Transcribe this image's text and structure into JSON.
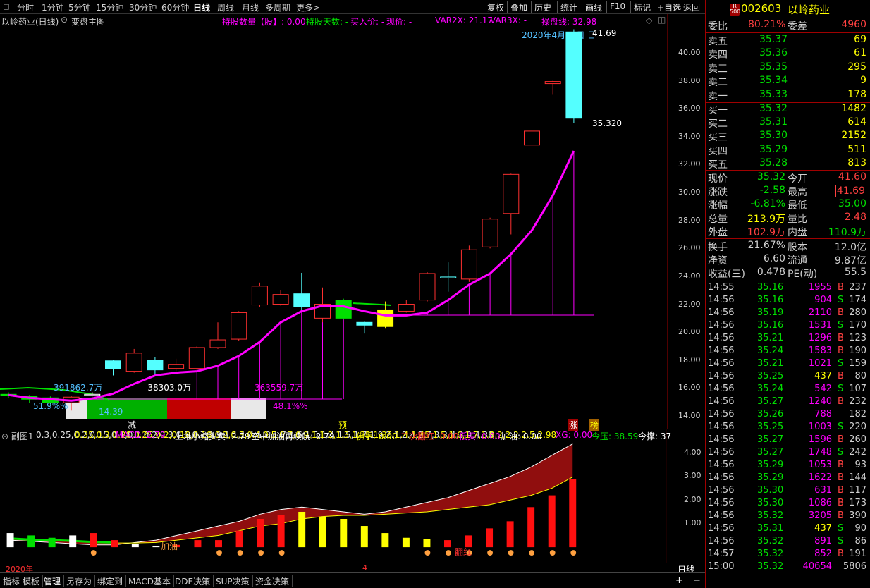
{
  "toolbar": {
    "periods": [
      "分时",
      "1分钟",
      "5分钟",
      "15分钟",
      "30分钟",
      "60分钟",
      "日线",
      "周线",
      "月线",
      "多周期",
      "更多>"
    ],
    "active_period": "日线",
    "right_buttons": [
      "复权",
      "叠加",
      "历史",
      "统计",
      "画线",
      "F10",
      "标记",
      "+自选",
      "返回"
    ]
  },
  "chart_header": {
    "title": "以岭药业(日线)",
    "formula_name": "变盘主图",
    "holding_qty": "持股数量【股】: 0.00",
    "holding_days": "持股天数: -",
    "buy_price": "买入价: -",
    "current_price": "现价: -",
    "var2x": "VAR2X: 21.17",
    "var3x": "VAR3X: -",
    "op_line": "操盘线: 32.98",
    "date_label": "2020年4月17日",
    "tooltip_prefix": "日"
  },
  "main_chart": {
    "y_ticks": [
      "40.00",
      "38.00",
      "36.00",
      "34.00",
      "32.00",
      "30.00",
      "28.00",
      "26.00",
      "24.00",
      "22.00",
      "20.00",
      "18.00",
      "16.00",
      "14.00"
    ],
    "annotations": {
      "high_value": "41.69",
      "low_value": "35.320",
      "vol1": "391862.7万",
      "vol2": "-38303.0万",
      "vol3": "363559.7万",
      "pct1": "51.9%%",
      "pct2": "48.1%%",
      "low_marker": "14.39",
      "sign_jian": "减",
      "sign_yu": "预",
      "sign_zhang": "涨",
      "sign_bang": "榜"
    },
    "candles": [
      {
        "o": 15.55,
        "c": 15.45,
        "h": 15.7,
        "l": 15.3,
        "t": "down"
      },
      {
        "o": 15.4,
        "c": 15.2,
        "h": 15.5,
        "l": 14.95,
        "t": "down"
      },
      {
        "o": 15.3,
        "c": 14.95,
        "h": 15.4,
        "l": 14.8,
        "t": "down"
      },
      {
        "o": 14.95,
        "c": 15.35,
        "h": 15.45,
        "l": 14.39,
        "t": "up"
      },
      {
        "o": 15.5,
        "c": 15.55,
        "h": 15.7,
        "l": 15.4,
        "t": "flat"
      },
      {
        "o": 17.4,
        "c": 17.95,
        "h": 18.0,
        "l": 16.9,
        "t": "cyan"
      },
      {
        "o": 17.2,
        "c": 18.5,
        "h": 18.8,
        "l": 17.1,
        "t": "up"
      },
      {
        "o": 17.3,
        "c": 18.0,
        "h": 18.2,
        "l": 16.95,
        "t": "cyan"
      },
      {
        "o": 17.4,
        "c": 17.7,
        "h": 18.1,
        "l": 17.2,
        "t": "up"
      },
      {
        "o": 17.4,
        "c": 18.9,
        "h": 19.0,
        "l": 17.3,
        "t": "up"
      },
      {
        "o": 18.9,
        "c": 19.45,
        "h": 20.7,
        "l": 18.8,
        "t": "up"
      },
      {
        "o": 19.5,
        "c": 21.4,
        "h": 21.5,
        "l": 19.4,
        "t": "up"
      },
      {
        "o": 21.95,
        "c": 23.3,
        "h": 23.55,
        "l": 21.8,
        "t": "up"
      },
      {
        "o": 22.0,
        "c": 22.7,
        "h": 23.0,
        "l": 21.9,
        "t": "up"
      },
      {
        "o": 22.75,
        "c": 21.8,
        "h": 24.25,
        "l": 21.6,
        "t": "cyan"
      },
      {
        "o": 21.0,
        "c": 22.0,
        "h": 23.2,
        "l": 20.7,
        "t": "up"
      },
      {
        "o": 22.3,
        "c": 21.0,
        "h": 22.4,
        "l": 20.9,
        "t": "green"
      },
      {
        "o": 20.7,
        "c": 20.5,
        "h": 20.75,
        "l": 19.9,
        "t": "cyan"
      },
      {
        "o": 20.4,
        "c": 21.6,
        "h": 22.2,
        "l": 20.3,
        "t": "yellow"
      },
      {
        "o": 21.5,
        "c": 22.0,
        "h": 22.3,
        "l": 21.4,
        "t": "up"
      },
      {
        "o": 22.3,
        "c": 24.2,
        "h": 24.3,
        "l": 22.2,
        "t": "up"
      },
      {
        "o": 23.9,
        "c": 23.95,
        "h": 25.0,
        "l": 22.9,
        "t": "cross"
      },
      {
        "o": 23.8,
        "c": 25.9,
        "h": 26.2,
        "l": 23.6,
        "t": "up"
      },
      {
        "o": 26.1,
        "c": 28.1,
        "h": 28.2,
        "l": 26.0,
        "t": "up"
      },
      {
        "o": 28.5,
        "c": 31.3,
        "h": 31.35,
        "l": 27.0,
        "t": "up"
      },
      {
        "o": 33.4,
        "c": 34.4,
        "h": 34.4,
        "l": 32.6,
        "t": "up"
      },
      {
        "o": 37.8,
        "c": 37.95,
        "h": 38.0,
        "l": 37.0,
        "t": "up"
      },
      {
        "o": 41.5,
        "c": 35.32,
        "h": 41.69,
        "l": 35.0,
        "t": "cyan"
      }
    ],
    "ma": [
      15.5,
      15.3,
      15.2,
      15.1,
      15.25,
      15.6,
      16.3,
      16.9,
      17.1,
      17.2,
      17.6,
      18.3,
      19.3,
      20.7,
      21.5,
      21.9,
      21.85,
      21.5,
      21.2,
      21.2,
      21.4,
      22.3,
      23.4,
      24.2,
      25.6,
      27.3,
      29.8,
      32.98
    ]
  },
  "sub_chart": {
    "header_name": "副图1",
    "dif": [
      0.3,
      0.25,
      0.2,
      0.15,
      0.1,
      0.1,
      0.2,
      0.3,
      0.5,
      0.7,
      0.9,
      1.1,
      1.4,
      1.6,
      1.7,
      1.6,
      1.5,
      1.4,
      1.5,
      1.7,
      1.9,
      2.1,
      2.4,
      2.7,
      3.0,
      3.4,
      3.9,
      4.38
    ],
    "dea": [
      0.35,
      0.3,
      0.28,
      0.25,
      0.2,
      0.18,
      0.18,
      0.2,
      0.3,
      0.4,
      0.5,
      0.7,
      0.9,
      1.0,
      1.2,
      1.3,
      1.35,
      1.35,
      1.4,
      1.45,
      1.5,
      1.6,
      1.7,
      1.8,
      2.0,
      2.2,
      2.5,
      2.98
    ],
    "macd": "MACD: 2.79",
    "l1": "上堆小缩头卖: 2.79",
    "l2": "空中加油再续航: 2.79",
    "l3": "佛手: 0.00",
    "l4": "二次翻红: 0.00",
    "l5": "低买: 0.00",
    "l6": "加油: 0.00",
    "xg": "XG: 0.00",
    "jinya": "今压: 38.59",
    "jincheng": "今撑: 37",
    "y_ticks": [
      "4.00",
      "3.00",
      "2.00",
      "1.00"
    ],
    "label_jiayou": "加油",
    "label_fanhong": "翻红",
    "bars": [
      0.6,
      0.5,
      0.4,
      0.5,
      0.6,
      0.3,
      0.15,
      0.05,
      0.1,
      0.3,
      0.3,
      0.7,
      1.2,
      1.35,
      1.5,
      1.3,
      1.2,
      0.9,
      0.6,
      0.4,
      0.35,
      0.3,
      0.5,
      0.8,
      1.1,
      1.7,
      2.2,
      2.9,
      2.8
    ],
    "bar_colors": [
      "white",
      "green",
      "green",
      "white",
      "red",
      "red",
      "white",
      "white",
      "red",
      "red",
      "red",
      "red",
      "red",
      "red",
      "yellow",
      "yellow",
      "yellow",
      "yellow",
      "yellow",
      "yellow",
      "yellow",
      "red",
      "red",
      "red",
      "red",
      "red",
      "red",
      "red",
      "yellow"
    ]
  },
  "date_bar": {
    "year": "2020年",
    "month": "4",
    "period_label": "日线"
  },
  "bottom_tabs": [
    "指标",
    "模板",
    "管理",
    "另存为",
    "绑定到",
    "MACD基本",
    "DDE决策",
    "SUP决策",
    "资金决策"
  ],
  "bottom_controls": [
    "+",
    "−"
  ],
  "quote": {
    "badge_top": "R",
    "badge_bottom": "500",
    "code": "002603",
    "name": "以岭药业",
    "weibi_label": "委比",
    "weibi": "80.21%",
    "weicha_label": "委差",
    "weicha": "4960",
    "asks": [
      {
        "label": "卖五",
        "price": "35.37",
        "vol": "69"
      },
      {
        "label": "卖四",
        "price": "35.36",
        "vol": "61"
      },
      {
        "label": "卖三",
        "price": "35.35",
        "vol": "295"
      },
      {
        "label": "卖二",
        "price": "35.34",
        "vol": "9"
      },
      {
        "label": "卖一",
        "price": "35.33",
        "vol": "178"
      }
    ],
    "bids": [
      {
        "label": "买一",
        "price": "35.32",
        "vol": "1482"
      },
      {
        "label": "买二",
        "price": "35.31",
        "vol": "614"
      },
      {
        "label": "买三",
        "price": "35.30",
        "vol": "2152"
      },
      {
        "label": "买四",
        "price": "35.29",
        "vol": "511"
      },
      {
        "label": "买五",
        "price": "35.28",
        "vol": "813"
      }
    ],
    "stats": [
      {
        "l1": "现价",
        "v1": "35.32",
        "c1": "#00e000",
        "l2": "今开",
        "v2": "41.60",
        "c2": "#ff4040"
      },
      {
        "l1": "涨跌",
        "v1": "-2.58",
        "c1": "#00e000",
        "l2": "最高",
        "v2": "41.69",
        "c2": "#ff4040",
        "box": true
      },
      {
        "l1": "涨幅",
        "v1": "-6.81%",
        "c1": "#00e000",
        "l2": "最低",
        "v2": "35.00",
        "c2": "#00e000"
      },
      {
        "l1": "总量",
        "v1": "213.9万",
        "c1": "#ffff00",
        "l2": "量比",
        "v2": "2.48",
        "c2": "#ff4040"
      },
      {
        "l1": "外盘",
        "v1": "102.9万",
        "c1": "#ff4040",
        "l2": "内盘",
        "v2": "110.9万",
        "c2": "#00e000"
      }
    ],
    "fundamentals": [
      {
        "l1": "换手",
        "v1": "21.67%",
        "l2": "股本",
        "v2": "12.0亿"
      },
      {
        "l1": "净资",
        "v1": "6.60",
        "l2": "流通",
        "v2": "9.87亿"
      },
      {
        "l1": "收益(三)",
        "v1": "0.478",
        "l2": "PE(动)",
        "v2": "55.5"
      }
    ],
    "ticks": [
      {
        "t": "14:55",
        "p": "35.16",
        "v": "1955",
        "bs": "B",
        "n": "237"
      },
      {
        "t": "14:56",
        "p": "35.16",
        "v": "904",
        "bs": "S",
        "n": "174"
      },
      {
        "t": "14:56",
        "p": "35.19",
        "v": "2110",
        "bs": "B",
        "n": "280"
      },
      {
        "t": "14:56",
        "p": "35.16",
        "v": "1531",
        "bs": "S",
        "n": "170"
      },
      {
        "t": "14:56",
        "p": "35.21",
        "v": "1296",
        "bs": "B",
        "n": "123"
      },
      {
        "t": "14:56",
        "p": "35.24",
        "v": "1583",
        "bs": "B",
        "n": "190"
      },
      {
        "t": "14:56",
        "p": "35.21",
        "v": "1021",
        "bs": "S",
        "n": "159"
      },
      {
        "t": "14:56",
        "p": "35.25",
        "v": "437",
        "bs": "B",
        "n": "80"
      },
      {
        "t": "14:56",
        "p": "35.24",
        "v": "542",
        "bs": "S",
        "n": "107"
      },
      {
        "t": "14:56",
        "p": "35.27",
        "v": "1240",
        "bs": "B",
        "n": "232"
      },
      {
        "t": "14:56",
        "p": "35.26",
        "v": "788",
        "bs": "",
        "n": "182"
      },
      {
        "t": "14:56",
        "p": "35.25",
        "v": "1003",
        "bs": "S",
        "n": "220"
      },
      {
        "t": "14:56",
        "p": "35.27",
        "v": "1596",
        "bs": "B",
        "n": "260"
      },
      {
        "t": "14:56",
        "p": "35.27",
        "v": "1748",
        "bs": "S",
        "n": "242"
      },
      {
        "t": "14:56",
        "p": "35.29",
        "v": "1053",
        "bs": "B",
        "n": "93"
      },
      {
        "t": "14:56",
        "p": "35.29",
        "v": "1622",
        "bs": "B",
        "n": "144"
      },
      {
        "t": "14:56",
        "p": "35.30",
        "v": "631",
        "bs": "B",
        "n": "117"
      },
      {
        "t": "14:56",
        "p": "35.30",
        "v": "1086",
        "bs": "B",
        "n": "173"
      },
      {
        "t": "14:56",
        "p": "35.32",
        "v": "3205",
        "bs": "B",
        "n": "390"
      },
      {
        "t": "14:56",
        "p": "35.31",
        "v": "437",
        "bs": "S",
        "n": "90"
      },
      {
        "t": "14:56",
        "p": "35.32",
        "v": "891",
        "bs": "S",
        "n": "86"
      },
      {
        "t": "14:57",
        "p": "35.32",
        "v": "852",
        "bs": "B",
        "n": "191"
      },
      {
        "t": "15:00",
        "p": "35.32",
        "v": "40654",
        "bs": "",
        "n": "5806"
      }
    ]
  },
  "colors": {
    "up": "#ff3030",
    "down": "#00e000",
    "cyan": "#54ffff",
    "ma": "#ff00ff",
    "yellow": "#ffff00",
    "frame": "#a00000"
  }
}
